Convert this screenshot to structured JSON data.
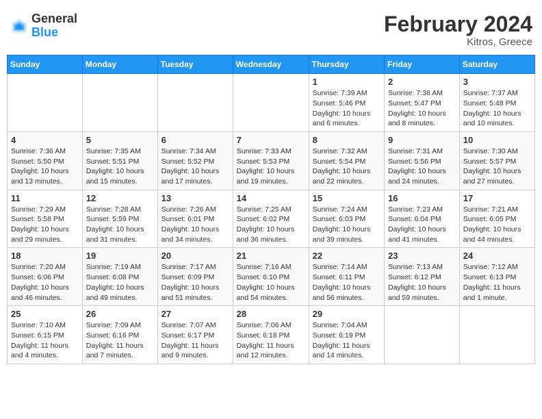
{
  "header": {
    "logo_general": "General",
    "logo_blue": "Blue",
    "title": "February 2024",
    "location": "Kitros, Greece"
  },
  "weekdays": [
    "Sunday",
    "Monday",
    "Tuesday",
    "Wednesday",
    "Thursday",
    "Friday",
    "Saturday"
  ],
  "weeks": [
    [
      {
        "day": "",
        "info": ""
      },
      {
        "day": "",
        "info": ""
      },
      {
        "day": "",
        "info": ""
      },
      {
        "day": "",
        "info": ""
      },
      {
        "day": "1",
        "info": "Sunrise: 7:39 AM\nSunset: 5:46 PM\nDaylight: 10 hours\nand 6 minutes."
      },
      {
        "day": "2",
        "info": "Sunrise: 7:38 AM\nSunset: 5:47 PM\nDaylight: 10 hours\nand 8 minutes."
      },
      {
        "day": "3",
        "info": "Sunrise: 7:37 AM\nSunset: 5:48 PM\nDaylight: 10 hours\nand 10 minutes."
      }
    ],
    [
      {
        "day": "4",
        "info": "Sunrise: 7:36 AM\nSunset: 5:50 PM\nDaylight: 10 hours\nand 13 minutes."
      },
      {
        "day": "5",
        "info": "Sunrise: 7:35 AM\nSunset: 5:51 PM\nDaylight: 10 hours\nand 15 minutes."
      },
      {
        "day": "6",
        "info": "Sunrise: 7:34 AM\nSunset: 5:52 PM\nDaylight: 10 hours\nand 17 minutes."
      },
      {
        "day": "7",
        "info": "Sunrise: 7:33 AM\nSunset: 5:53 PM\nDaylight: 10 hours\nand 19 minutes."
      },
      {
        "day": "8",
        "info": "Sunrise: 7:32 AM\nSunset: 5:54 PM\nDaylight: 10 hours\nand 22 minutes."
      },
      {
        "day": "9",
        "info": "Sunrise: 7:31 AM\nSunset: 5:56 PM\nDaylight: 10 hours\nand 24 minutes."
      },
      {
        "day": "10",
        "info": "Sunrise: 7:30 AM\nSunset: 5:57 PM\nDaylight: 10 hours\nand 27 minutes."
      }
    ],
    [
      {
        "day": "11",
        "info": "Sunrise: 7:29 AM\nSunset: 5:58 PM\nDaylight: 10 hours\nand 29 minutes."
      },
      {
        "day": "12",
        "info": "Sunrise: 7:28 AM\nSunset: 5:59 PM\nDaylight: 10 hours\nand 31 minutes."
      },
      {
        "day": "13",
        "info": "Sunrise: 7:26 AM\nSunset: 6:01 PM\nDaylight: 10 hours\nand 34 minutes."
      },
      {
        "day": "14",
        "info": "Sunrise: 7:25 AM\nSunset: 6:02 PM\nDaylight: 10 hours\nand 36 minutes."
      },
      {
        "day": "15",
        "info": "Sunrise: 7:24 AM\nSunset: 6:03 PM\nDaylight: 10 hours\nand 39 minutes."
      },
      {
        "day": "16",
        "info": "Sunrise: 7:23 AM\nSunset: 6:04 PM\nDaylight: 10 hours\nand 41 minutes."
      },
      {
        "day": "17",
        "info": "Sunrise: 7:21 AM\nSunset: 6:05 PM\nDaylight: 10 hours\nand 44 minutes."
      }
    ],
    [
      {
        "day": "18",
        "info": "Sunrise: 7:20 AM\nSunset: 6:06 PM\nDaylight: 10 hours\nand 46 minutes."
      },
      {
        "day": "19",
        "info": "Sunrise: 7:19 AM\nSunset: 6:08 PM\nDaylight: 10 hours\nand 49 minutes."
      },
      {
        "day": "20",
        "info": "Sunrise: 7:17 AM\nSunset: 6:09 PM\nDaylight: 10 hours\nand 51 minutes."
      },
      {
        "day": "21",
        "info": "Sunrise: 7:16 AM\nSunset: 6:10 PM\nDaylight: 10 hours\nand 54 minutes."
      },
      {
        "day": "22",
        "info": "Sunrise: 7:14 AM\nSunset: 6:11 PM\nDaylight: 10 hours\nand 56 minutes."
      },
      {
        "day": "23",
        "info": "Sunrise: 7:13 AM\nSunset: 6:12 PM\nDaylight: 10 hours\nand 59 minutes."
      },
      {
        "day": "24",
        "info": "Sunrise: 7:12 AM\nSunset: 6:13 PM\nDaylight: 11 hours\nand 1 minute."
      }
    ],
    [
      {
        "day": "25",
        "info": "Sunrise: 7:10 AM\nSunset: 6:15 PM\nDaylight: 11 hours\nand 4 minutes."
      },
      {
        "day": "26",
        "info": "Sunrise: 7:09 AM\nSunset: 6:16 PM\nDaylight: 11 hours\nand 7 minutes."
      },
      {
        "day": "27",
        "info": "Sunrise: 7:07 AM\nSunset: 6:17 PM\nDaylight: 11 hours\nand 9 minutes."
      },
      {
        "day": "28",
        "info": "Sunrise: 7:06 AM\nSunset: 6:18 PM\nDaylight: 11 hours\nand 12 minutes."
      },
      {
        "day": "29",
        "info": "Sunrise: 7:04 AM\nSunset: 6:19 PM\nDaylight: 11 hours\nand 14 minutes."
      },
      {
        "day": "",
        "info": ""
      },
      {
        "day": "",
        "info": ""
      }
    ]
  ]
}
